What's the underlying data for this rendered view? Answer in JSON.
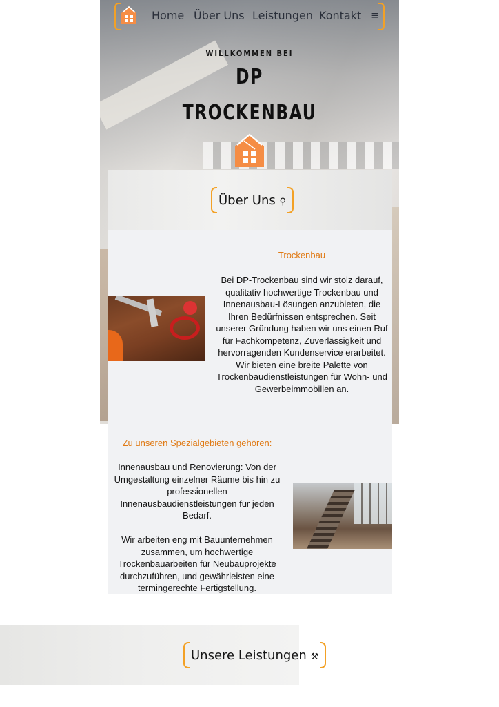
{
  "nav": {
    "items": [
      "Home",
      "Über Uns",
      "Leistungen",
      "Kontakt"
    ],
    "menu_icon": "≡"
  },
  "hero": {
    "welcome": "WILLKOMMEN BEI",
    "title_line1": "DP",
    "title_line2": "TROCKENBAU"
  },
  "about": {
    "heading": "Über Uns",
    "heading_icon": "♀",
    "block1_title": "Trockenbau",
    "block1_text": "Bei DP-Trockenbau sind wir stolz darauf, qualitativ hochwertige Trockenbau und Innenausbau-Lösungen anzubieten, die Ihren Bedürfnissen entsprechen. Seit unserer Gründung haben wir uns einen Ruf für Fachkompetenz, Zuverlässigkeit und hervorragenden Kundenservice erarbeitet. Wir bieten eine breite Palette von Trockenbaudienstleistungen für Wohn- und Gewerbeimmobilien an.",
    "block2_title": "Zu unseren Spezialgebieten gehören:",
    "block2_text1": "Innenausbau und Renovierung: Von der Umgestaltung einzelner Räume bis hin zu professionellen Innenausbaudienstleistungen für jeden Bedarf.",
    "block2_text2": "Wir arbeiten eng mit Bauunternehmen zusammen, um hochwertige Trockenbauarbeiten für Neubauprojekte durchzuführen, und gewährleisten eine termingerechte Fertigstellung."
  },
  "services": {
    "heading": "Unsere Leistungen",
    "heading_icon": "⚒"
  },
  "colors": {
    "accent": "#f3a126",
    "logo_orange": "#f58d45",
    "subtitle_orange": "#e07a14"
  }
}
